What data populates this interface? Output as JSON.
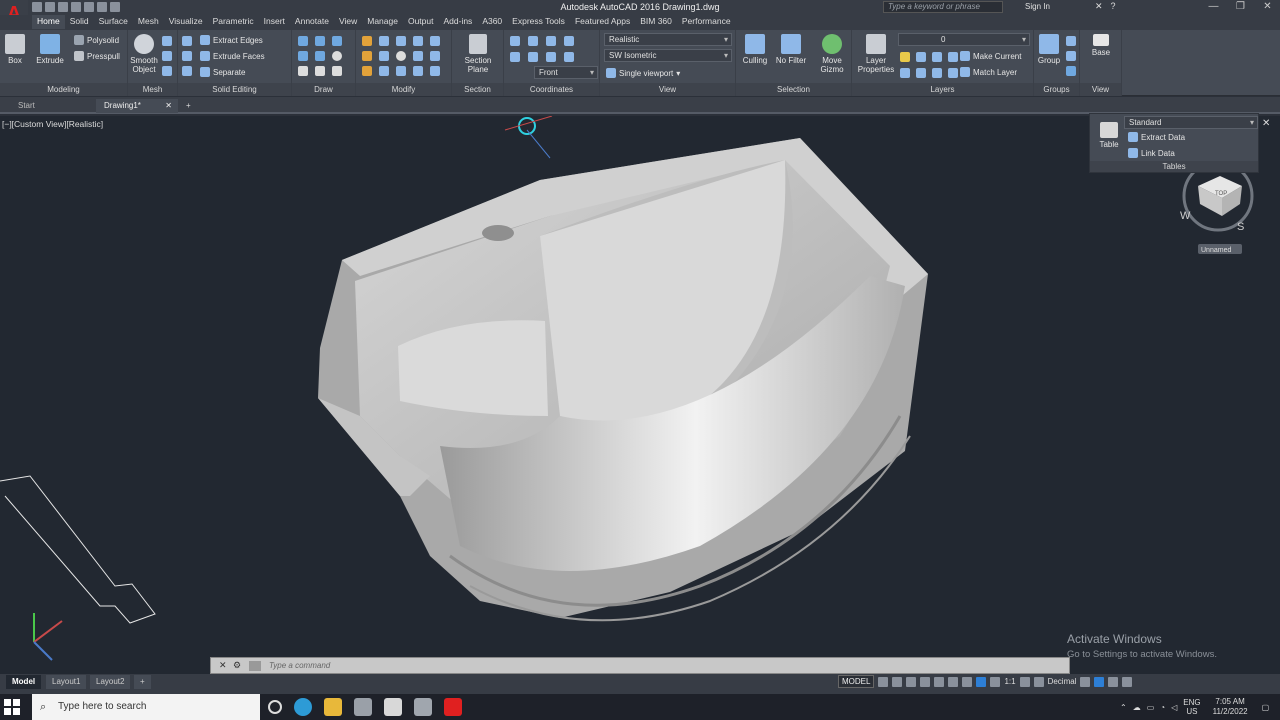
{
  "window": {
    "title": "Autodesk AutoCAD 2016   Drawing1.dwg",
    "search_placeholder": "Type a keyword or phrase",
    "sign_in": "Sign In"
  },
  "ribbon_tabs": [
    "Home",
    "Solid",
    "Surface",
    "Mesh",
    "Visualize",
    "Parametric",
    "Insert",
    "Annotate",
    "View",
    "Manage",
    "Output",
    "Add-ins",
    "A360",
    "Express Tools",
    "Featured Apps",
    "BIM 360",
    "Performance"
  ],
  "modeling": {
    "box": "Box",
    "extrude": "Extrude",
    "polysolid": "Polysolid",
    "presspull": "Presspull",
    "label": "Modeling"
  },
  "mesh": {
    "smooth_object": "Smooth Object",
    "label": "Mesh"
  },
  "solid_editing": {
    "extract_edges": "Extract Edges",
    "extrude_faces": "Extrude Faces",
    "separate": "Separate",
    "label": "Solid Editing"
  },
  "draw": {
    "label": "Draw"
  },
  "modify": {
    "label": "Modify"
  },
  "section": {
    "section_plane": "Section Plane",
    "label": "Section"
  },
  "coordinates": {
    "label": "Coordinates"
  },
  "view": {
    "visual_style": "Realistic",
    "view_name": "SW Isometric",
    "ucs": "Front",
    "viewport": "Single viewport",
    "label": "View"
  },
  "selection": {
    "culling": "Culling",
    "no_filter": "No Filter",
    "move_gizmo": "Move Gizmo",
    "label": "Selection"
  },
  "layers": {
    "layer_properties": "Layer Properties",
    "layer_value": "0",
    "make_current": "Make Current",
    "match_layer": "Match Layer",
    "label": "Layers"
  },
  "groups": {
    "group": "Group",
    "label": "Groups"
  },
  "view2": {
    "base": "Base",
    "label": "View"
  },
  "doc_tabs": [
    "Start",
    "Drawing1*"
  ],
  "viewport": {
    "label": "[−][Custom View][Realistic]"
  },
  "tables_panel": {
    "style": "Standard",
    "table": "Table",
    "extract_data": "Extract Data",
    "link_data": "Link Data",
    "label": "Tables"
  },
  "viewcube": {
    "top": "TOP",
    "w": "W",
    "s": "S",
    "ucs_name": "Unnamed"
  },
  "watermark": {
    "line1": "Activate Windows",
    "line2": "Go to Settings to activate Windows."
  },
  "command": {
    "placeholder": "Type a command"
  },
  "layout_tabs": [
    "Model",
    "Layout1",
    "Layout2"
  ],
  "status": {
    "model": "MODEL",
    "scale": "1:1",
    "units": "Decimal"
  },
  "taskbar": {
    "search": "Type here to search",
    "lang": "ENG",
    "region": "US",
    "time": "7:05 AM",
    "date": "11/2/2022"
  },
  "colors": {
    "accent": "#2d7fd6",
    "autocad_red": "#e02020",
    "viewport_bg": "#222831"
  }
}
